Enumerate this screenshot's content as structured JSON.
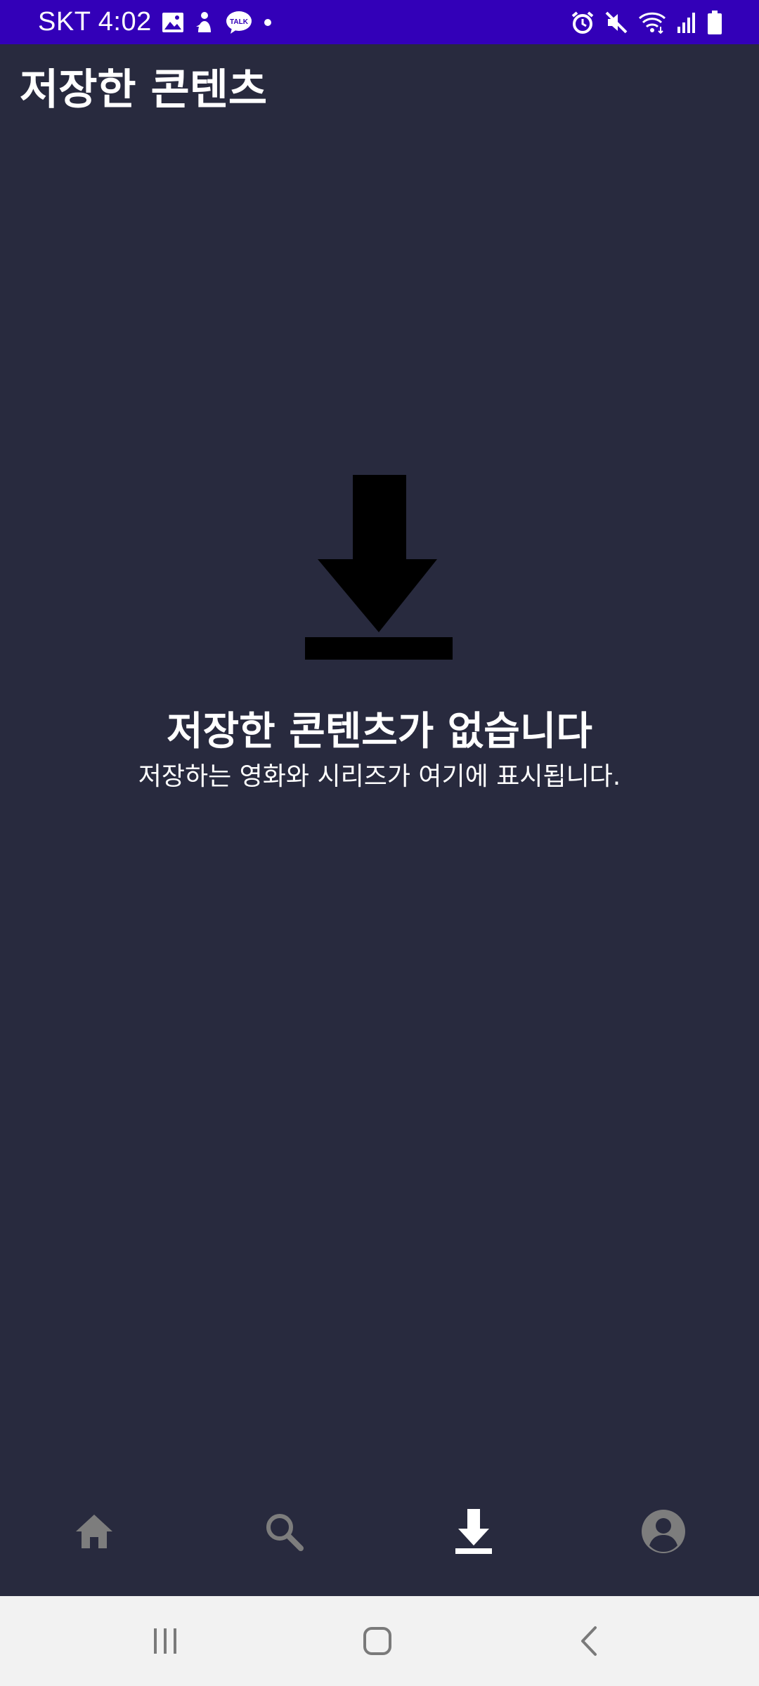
{
  "status_bar": {
    "carrier_time": "SKT 4:02",
    "left_icons": [
      "gallery-icon",
      "notification-figure-icon",
      "kakaotalk-icon",
      "dot-icon"
    ],
    "talk_badge": "TALK",
    "right_icons": [
      "alarm-icon",
      "mute-icon",
      "wifi-icon",
      "signal-icon",
      "battery-icon"
    ]
  },
  "header": {
    "title": "저장한 콘텐츠"
  },
  "empty_state": {
    "icon": "download-icon",
    "title": "저장한 콘텐츠가 없습니다",
    "subtitle": "저장하는 영화와 시리즈가 여기에 표시됩니다."
  },
  "tab_bar": {
    "tabs": [
      {
        "id": "home",
        "icon": "home-icon",
        "active": false
      },
      {
        "id": "search",
        "icon": "search-icon",
        "active": false
      },
      {
        "id": "downloads",
        "icon": "download-icon",
        "active": true
      },
      {
        "id": "profile",
        "icon": "profile-icon",
        "active": false
      }
    ]
  },
  "system_nav": {
    "buttons": [
      "recent-apps-icon",
      "home-button-icon",
      "back-icon"
    ]
  },
  "colors": {
    "background": "#282a3e",
    "status_bar": "#3300b8",
    "text": "#ffffff",
    "tab_inactive": "#7d7d7d",
    "tab_active": "#ffffff",
    "nav_bar": "#f2f2f2"
  }
}
